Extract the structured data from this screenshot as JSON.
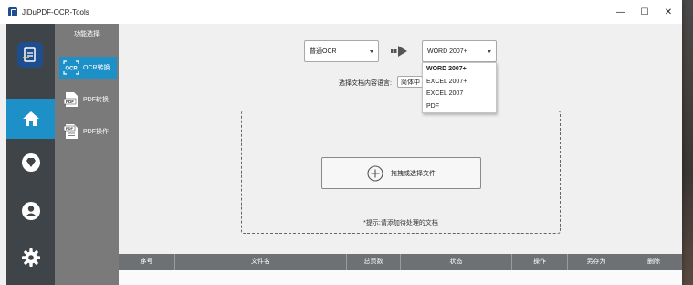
{
  "window": {
    "title": "JiDuPDF-OCR-Tools",
    "controls": {
      "minimize": "—",
      "maximize": "☐",
      "close": "✕"
    }
  },
  "nav": {
    "items": [
      {
        "name": "home-icon",
        "active": true
      },
      {
        "name": "vip-diamond-icon",
        "active": false
      },
      {
        "name": "user-icon",
        "active": false
      },
      {
        "name": "settings-icon",
        "active": false
      }
    ]
  },
  "submenu": {
    "title": "功能选择",
    "items": [
      {
        "label": "OCR转换",
        "icon": "ocr-icon",
        "active": true
      },
      {
        "label": "PDF转换",
        "icon": "pdf-icon",
        "active": false
      },
      {
        "label": "PDF操作",
        "icon": "pdf-operate-icon",
        "active": false
      }
    ]
  },
  "main": {
    "mode_select": {
      "value": "普通OCR"
    },
    "format_select": {
      "value": "WORD 2007+"
    },
    "format_options": [
      "WORD 2007+",
      "EXCEL 2007+",
      "EXCEL 2007",
      "PDF"
    ],
    "lang_label": "选择文档内容语言:",
    "lang_select": {
      "value": "简体中"
    },
    "select_file_label": "拖拽或选择文件",
    "hint": "*提示:请添加待处理的文档"
  },
  "table": {
    "columns": [
      "序号",
      "文件名",
      "总页数",
      "状态",
      "操作",
      "另存为",
      "删除"
    ]
  },
  "colors": {
    "accent": "#1e90c8",
    "nav_bg": "#3f4448",
    "submenu_bg": "#7a7a7a",
    "header_bg": "#6e7173"
  }
}
